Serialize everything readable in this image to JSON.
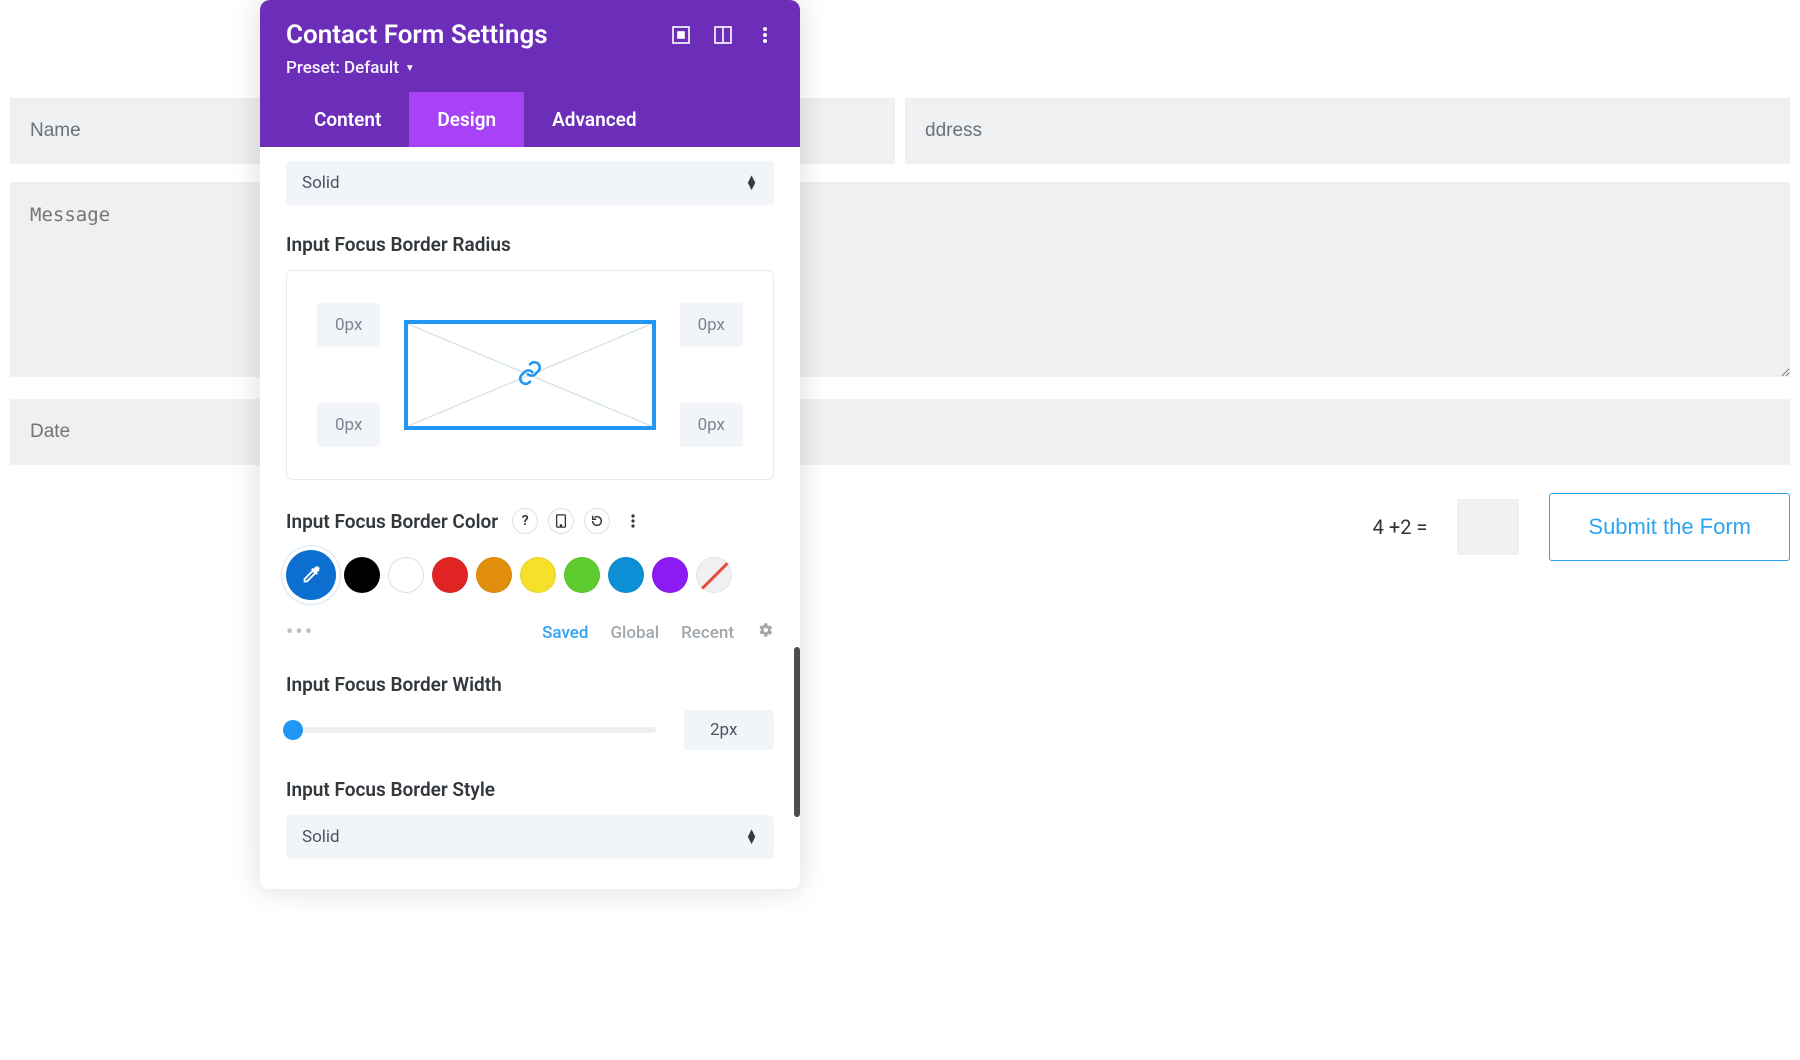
{
  "form": {
    "name_ph": "Name",
    "email_ph": "ddress",
    "message_ph": "Message",
    "date_ph": "Date",
    "captcha": "4 +2 =",
    "submit": "Submit the Form"
  },
  "panel": {
    "title": "Contact Form Settings",
    "preset": "Preset: Default",
    "tabs": {
      "content": "Content",
      "design": "Design",
      "advanced": "Advanced"
    },
    "border_style_top": "Solid",
    "radius": {
      "label": "Input Focus Border Radius",
      "tl": "0px",
      "tr": "0px",
      "bl": "0px",
      "br": "0px"
    },
    "color_label": "Input Focus Border Color",
    "swatches": [
      "#0d6fcf",
      "#000000",
      "#ffffff",
      "#e02424",
      "#e08e0b",
      "#f6e02a",
      "#5ecb2e",
      "#0d8fd6",
      "#8b1bf2"
    ],
    "palette_tabs": {
      "saved": "Saved",
      "global": "Global",
      "recent": "Recent"
    },
    "width": {
      "label": "Input Focus Border Width",
      "value": "2px"
    },
    "style2": {
      "label": "Input Focus Border Style",
      "value": "Solid"
    }
  }
}
